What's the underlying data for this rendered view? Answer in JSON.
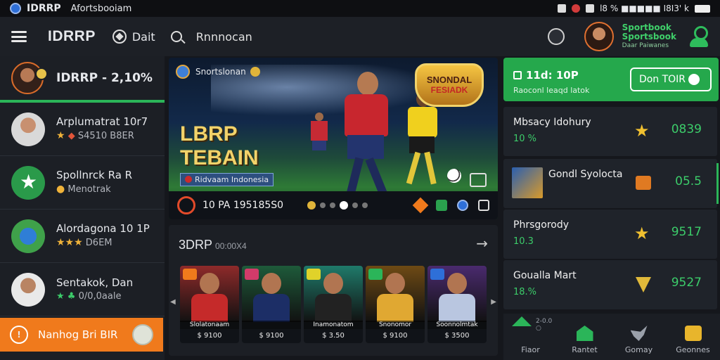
{
  "statusbar": {
    "app_name": "IDRRP",
    "app_sub": "Afortsbooiam",
    "right_text": "l8 % ■■■■■ I8I3' k"
  },
  "topbar": {
    "brand": "IDRRP",
    "nav_label": "Dait",
    "search_label": "Rnnnocan",
    "sportsbook_line1": "Sportbook",
    "sportsbook_line2": "Sportsbook",
    "sportsbook_line3": "Daar Paiwanes"
  },
  "left_panel": {
    "header_title": "IDRRP - 2,10%",
    "items": [
      {
        "name": "Arplumatrat 10r7",
        "meta": "S4510 B8ER",
        "kind": "p1"
      },
      {
        "name": "Spollnrck Ra R",
        "meta": "Menotrak",
        "kind": "p2"
      },
      {
        "name": "Alordagona 10 1P",
        "meta": "D6EM",
        "kind": "p3"
      },
      {
        "name": "Sentakok, Dan",
        "meta": "0/0,0aale",
        "kind": "p4"
      }
    ],
    "cta_label": "Nanhog Bri BIR"
  },
  "hero": {
    "tag_text": "Snortslonan",
    "headline_1": "LBRP",
    "headline_2": "TEBAIN",
    "country_label": "Ridvaam Indonesia",
    "badge_line1": "SNONDAL",
    "badge_line2": "FESIADK",
    "footer_stat": "10 PA 195185S0"
  },
  "cards_section": {
    "title": "3DRP",
    "subtitle": "00:00X4",
    "cards": [
      {
        "ribbon": "Slolatonaam",
        "price": "$ 9100",
        "bg": "#8e2a2a",
        "jersey": "#c52a2a",
        "badge": "#f07a1c"
      },
      {
        "ribbon": "",
        "price": "$ 9100",
        "bg": "#1e5a3a",
        "jersey": "#1c2e66",
        "badge": "#d23b6a"
      },
      {
        "ribbon": "Inamonatom",
        "price": "$ 3.50",
        "bg": "#1f7a6a",
        "jersey": "#222",
        "badge": "#e0d22a"
      },
      {
        "ribbon": "Snonomor",
        "price": "$ 9100",
        "bg": "#6e4a14",
        "jersey": "#e0a832",
        "badge": "#2bb559"
      },
      {
        "ribbon": "Soonnolmtak",
        "price": "$ 3500",
        "bg": "#4a2a6e",
        "jersey": "#b9c6e0",
        "badge": "#2e6fd8"
      }
    ]
  },
  "right_panel": {
    "promo_title": "11d: 10P",
    "promo_sub": "Raoconl leaqd latok",
    "promo_button": "Don TOIR",
    "rows": [
      {
        "label": "Mbsacy Idohury",
        "sub": "10 %",
        "value": "0839"
      },
      {
        "label": "Gondl Syolocta",
        "sub": "",
        "value": "05.5"
      },
      {
        "label": "Phrsgorody",
        "sub": "10.3",
        "value": "9517"
      },
      {
        "label": "Goualla Mart",
        "sub": "18.%",
        "value": "9527"
      }
    ]
  },
  "bottom_nav": {
    "arrow_label": "2-0.0 ○",
    "items": [
      "Fiaor",
      "Rantet",
      "Gomay",
      "Geonnes"
    ]
  },
  "colors": {
    "accent_green": "#2bb559",
    "accent_orange": "#f07a1c",
    "gold": "#f0c030"
  }
}
